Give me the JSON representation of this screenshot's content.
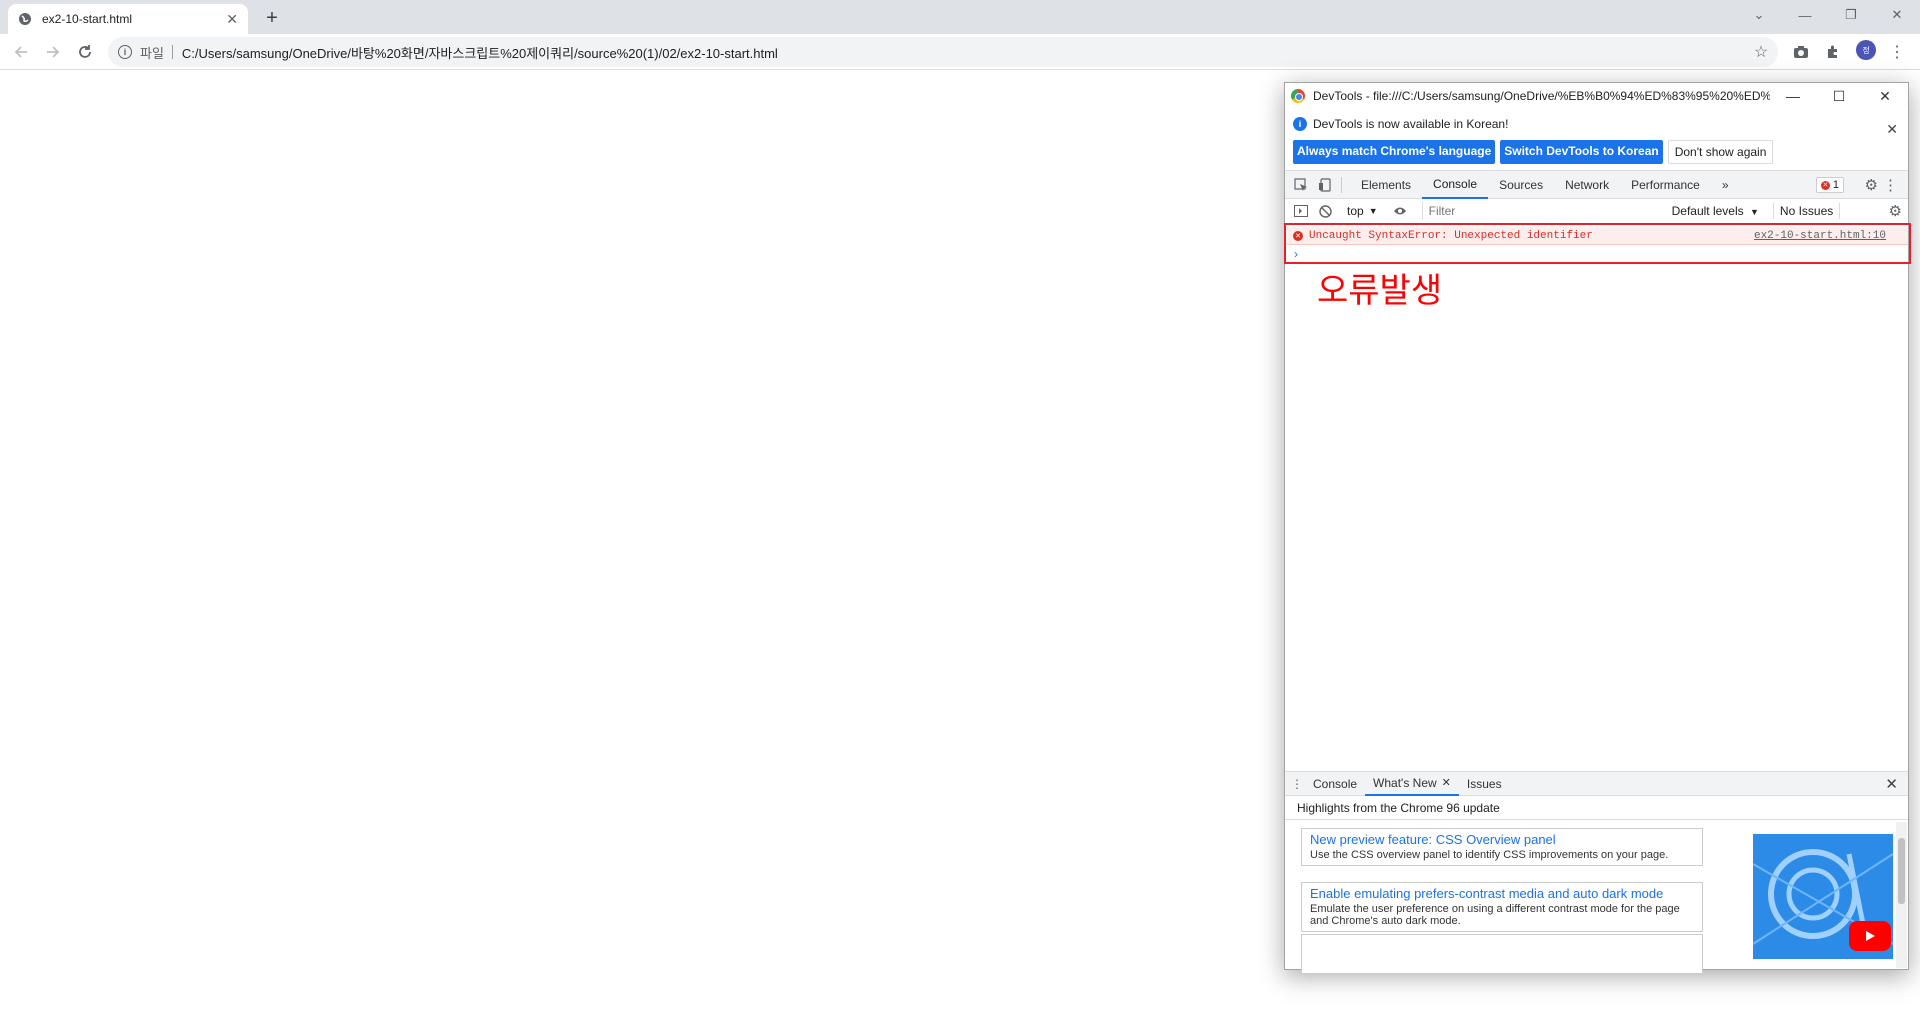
{
  "browser": {
    "tab_title": "ex2-10-start.html",
    "address_chip": "파일",
    "url": "C:/Users/samsung/OneDrive/바탕%20화면/자바스크립트%20제이쿼리/source%20(1)/02/ex2-10-start.html",
    "avatar_initial": "정"
  },
  "devtools": {
    "window_title": "DevTools - file:///C:/Users/samsung/OneDrive/%EB%B0%94%ED%83%95%20%ED%...",
    "infobar": {
      "message": "DevTools is now available in Korean!",
      "btn_match": "Always match Chrome's language",
      "btn_switch": "Switch DevTools to Korean",
      "btn_dismiss": "Don't show again"
    },
    "tabs": [
      "Elements",
      "Console",
      "Sources",
      "Network",
      "Performance"
    ],
    "active_tab": "Console",
    "more_tabs": "»",
    "error_count": "1",
    "filterbar": {
      "context": "top",
      "filter_placeholder": "Filter",
      "levels": "Default levels",
      "issues": "No Issues"
    },
    "console": {
      "error_message": "Uncaught SyntaxError: Unexpected identifier",
      "error_source": "ex2-10-start.html:10",
      "prompt": "›"
    },
    "annotation": "오류발생",
    "drawer": {
      "tabs": [
        "Console",
        "What's New",
        "Issues"
      ],
      "active_tab": "What's New",
      "highlights": "Highlights from the Chrome 96 update",
      "cards": [
        {
          "title": "New preview feature: CSS Overview panel",
          "desc": "Use the CSS overview panel to identify CSS improvements on your page."
        },
        {
          "title": "Enable emulating prefers-contrast media and auto dark mode",
          "desc": "Emulate the user preference on using a different contrast mode for the page and Chrome's auto dark mode."
        }
      ]
    }
  },
  "colors": {
    "accent": "#1a73e8",
    "error": "#d93025",
    "annotation": "#ff0000"
  }
}
